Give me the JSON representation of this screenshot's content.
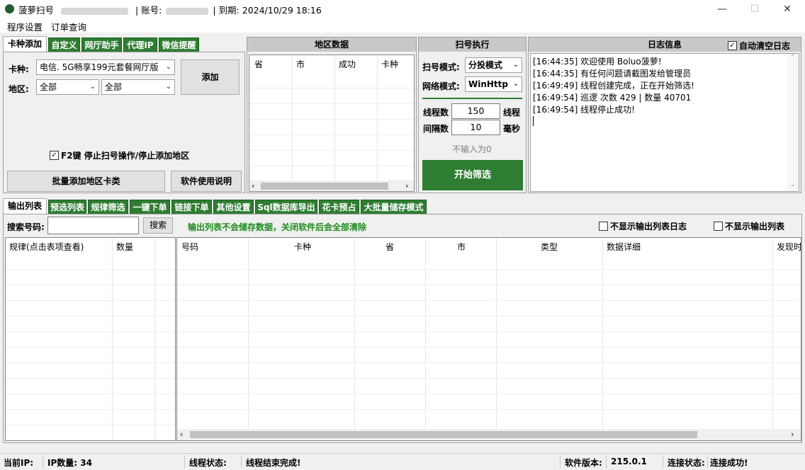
{
  "title": {
    "app_name": "菠萝扫号",
    "account_label": "| 账号:",
    "expiry_label": "| 到期:",
    "expiry_value": "2024/10/29 18:16"
  },
  "window_controls": {
    "minimize": "—",
    "maximize": "☐",
    "close": "✕"
  },
  "menu": {
    "items": [
      "程序设置",
      "订单查询"
    ]
  },
  "top_tabs": [
    "卡种添加",
    "自定义",
    "网厅助手",
    "代理IP",
    "微信提醒"
  ],
  "card_panel": {
    "card_type_label": "卡种:",
    "card_type_value": "电信. 5G畅享199元套餐网厅版",
    "region_label": "地区:",
    "province_value": "全部",
    "city_value": "全部",
    "add_button": "添加",
    "f2_checkbox_label": "F2键 停止扫号操作/停止添加地区",
    "batch_button": "批量添加地区卡类",
    "help_button": "软件使用说明"
  },
  "region_panel": {
    "title": "地区数据",
    "columns": [
      "省",
      "市",
      "成功",
      "卡种"
    ]
  },
  "scan_panel": {
    "title": "扫号执行",
    "mode_label": "扫号模式:",
    "mode_value": "分投模式",
    "network_label": "网络模式:",
    "network_value": "WinHttp",
    "threads_label": "线程数",
    "threads_value": "150",
    "threads_unit": "线程",
    "interval_label": "间隔数",
    "interval_value": "10",
    "interval_unit": "毫秒",
    "hint": "不输入为0",
    "start_button": "开始筛选"
  },
  "log_panel": {
    "title": "日志信息",
    "auto_clear_label": "自动清空日志",
    "lines": [
      "[16:44:35] 欢迎使用 Boluo菠萝!",
      "[16:44:35] 有任何问题请截图发给管理员",
      "[16:49:49] 线程创建完成，正在开始筛选!",
      "[16:49:54] 巡逻 次数 429 | 数量 40701",
      "[16:49:54] 线程停止成功!"
    ]
  },
  "bottom_tabs": [
    "输出列表",
    "预选列表",
    "规律筛选",
    "一键下单",
    "链接下单",
    "其他设置",
    "Sql数据库导出",
    "花卡预占",
    "大批量储存模式"
  ],
  "search": {
    "label": "搜索号码:",
    "value": "",
    "button": "搜索",
    "notice": "输出列表不会储存数据，关闭软件后会全部清除",
    "hide_log_label": "不显示输出列表日志",
    "hide_list_label": "不显示输出列表"
  },
  "rule_table": {
    "columns": [
      "规律(点击表项查看)",
      "数量"
    ]
  },
  "output_table": {
    "columns": [
      "号码",
      "卡种",
      "省",
      "市",
      "类型",
      "数据详细",
      "发现时"
    ]
  },
  "status": {
    "ip_label": "当前IP:",
    "ip_count": "IP数量:  34",
    "thread_state_label": "线程状态:",
    "thread_state_value": "线程结束完成!",
    "version_label": "软件版本:",
    "version_value": "215.0.1",
    "connect_label": "连接状态:",
    "connect_value": "连接成功!"
  },
  "colors": {
    "tab_green": "#2e7d32",
    "notice_green": "#1e8a1e",
    "start_button": "#2e7d32"
  }
}
